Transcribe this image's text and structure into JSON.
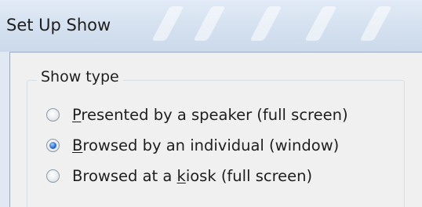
{
  "window": {
    "title": "Set Up Show"
  },
  "show_type": {
    "group_label": "Show type",
    "options": [
      {
        "pre": "",
        "accel": "P",
        "post": "resented by a speaker (full screen)",
        "selected": false
      },
      {
        "pre": "",
        "accel": "B",
        "post": "rowsed by an individual (window)",
        "selected": true
      },
      {
        "pre": "Browsed at a ",
        "accel": "k",
        "post": "iosk (full screen)",
        "selected": false
      }
    ]
  },
  "colors": {
    "title_bar": "#d4e0ef",
    "client_bg": "#f0f0f0",
    "radio_selected": "#2a6fd6"
  }
}
